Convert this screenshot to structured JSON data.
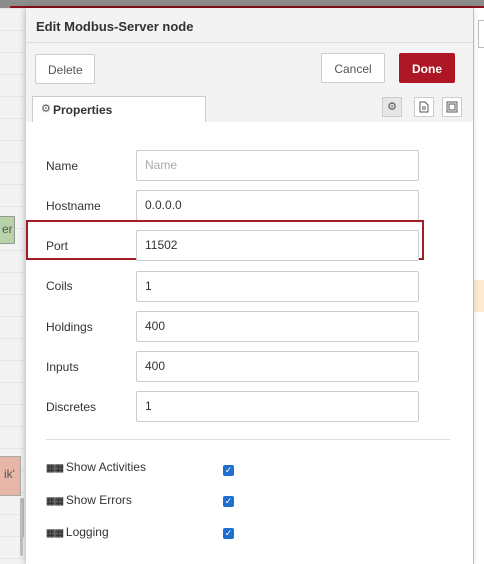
{
  "dialog": {
    "title": "Edit Modbus-Server node",
    "delete_label": "Delete",
    "cancel_label": "Cancel",
    "done_label": "Done"
  },
  "tabs": {
    "properties_label": "Properties",
    "icons": [
      "gear-icon",
      "description-icon",
      "appearance-icon"
    ]
  },
  "form": {
    "name": {
      "label": "Name",
      "placeholder": "Name",
      "value": ""
    },
    "hostname": {
      "label": "Hostname",
      "value": "0.0.0.0"
    },
    "port": {
      "label": "Port",
      "value": "11502"
    },
    "coils": {
      "label": "Coils",
      "value": "1"
    },
    "holdings": {
      "label": "Holdings",
      "value": "400"
    },
    "inputs": {
      "label": "Inputs",
      "value": "400"
    },
    "discretes": {
      "label": "Discretes",
      "value": "1"
    }
  },
  "options": [
    {
      "label": "Show Activities",
      "checked": true
    },
    {
      "label": "Show Errors",
      "checked": true
    },
    {
      "label": "Logging",
      "checked": true
    }
  ],
  "workspace": {
    "node_fragment_1": "er",
    "node_fragment_2": "ik'"
  },
  "colors": {
    "accent": "#ad1625",
    "highlight": "#a51c25",
    "checkbox": "#1f6fd0"
  }
}
